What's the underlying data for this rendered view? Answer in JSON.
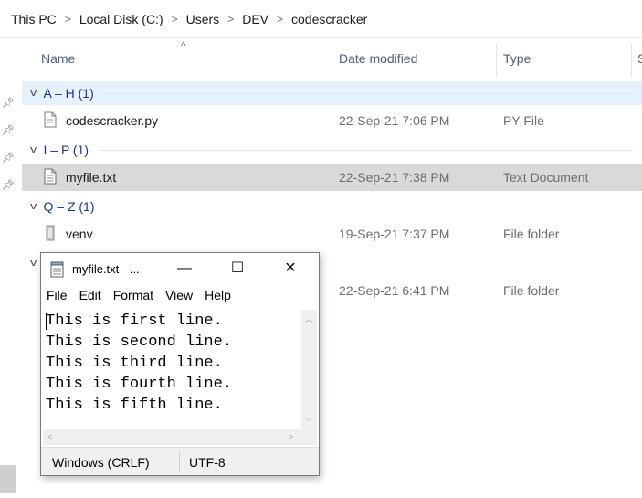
{
  "breadcrumb": [
    "This PC",
    "Local Disk (C:)",
    "Users",
    "DEV",
    "codescracker"
  ],
  "columns": {
    "name": "Name",
    "date": "Date modified",
    "type": "Type",
    "size": "S"
  },
  "groups": [
    {
      "label": "A – H (1)",
      "selected": true
    },
    {
      "label": "I – P (1)",
      "selected": false
    },
    {
      "label": "Q – Z (1)",
      "selected": false
    }
  ],
  "files": [
    {
      "name": "codescracker.py",
      "date": "22-Sep-21 7:06 PM",
      "type": "PY File",
      "icon": "py-file-icon",
      "selected": false
    },
    {
      "name": "myfile.txt",
      "date": "22-Sep-21 7:38 PM",
      "type": "Text Document",
      "icon": "text-file-icon",
      "selected": true
    },
    {
      "name": "venv",
      "date": "19-Sep-21 7:37 PM",
      "type": "File folder",
      "icon": "folder-icon",
      "selected": false
    },
    {
      "name": "",
      "date": "22-Sep-21 6:41 PM",
      "type": "File folder",
      "icon": "",
      "selected": false
    }
  ],
  "notepad": {
    "title": "myfile.txt - ...",
    "menu": [
      "File",
      "Edit",
      "Format",
      "View",
      "Help"
    ],
    "lines": [
      "This is first line.",
      "This is second line.",
      "This is third line.",
      "This is fourth line.",
      "This is fifth line."
    ],
    "status": {
      "line_ending": "Windows (CRLF)",
      "encoding": "UTF-8"
    },
    "controls": {
      "minimize": "—",
      "maximize": "☐",
      "close": "✕"
    }
  },
  "colors": {
    "group_text": "#1e3287",
    "header_text": "#4c607a",
    "selection_bg": "#d9d9d9",
    "group_selected_bg": "#e5f1fb"
  }
}
